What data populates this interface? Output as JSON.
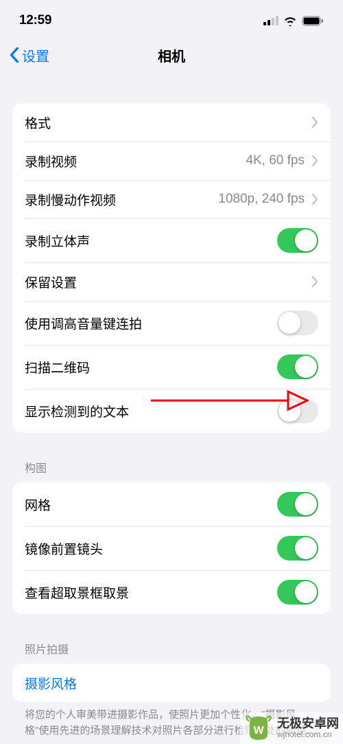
{
  "status": {
    "time": "12:59"
  },
  "nav": {
    "back": "设置",
    "title": "相机"
  },
  "section1": {
    "formats": "格式",
    "recordVideo": {
      "label": "录制视频",
      "value": "4K, 60 fps"
    },
    "recordSlomo": {
      "label": "录制慢动作视频",
      "value": "1080p, 240 fps"
    },
    "stereo": "录制立体声",
    "preserve": "保留设置",
    "volumeBurst": "使用调高音量键连拍",
    "scanQR": "扫描二维码",
    "detectedText": "显示检测到的文本"
  },
  "composition": {
    "header": "构图",
    "grid": "网格",
    "mirrorFront": "镜像前置镜头",
    "outsideFrame": "查看超取景框取景"
  },
  "capture": {
    "header": "照片拍摄",
    "styles": "摄影风格",
    "footer": "将您的个人审美带进摄影作品，使照片更加个性化。\"摄影风格\"使用先进的场景理解技术对照片各部分进行检则好处的调整。"
  },
  "watermark": {
    "main": "无极安卓网",
    "sub": "wjhotel.com.cn"
  }
}
